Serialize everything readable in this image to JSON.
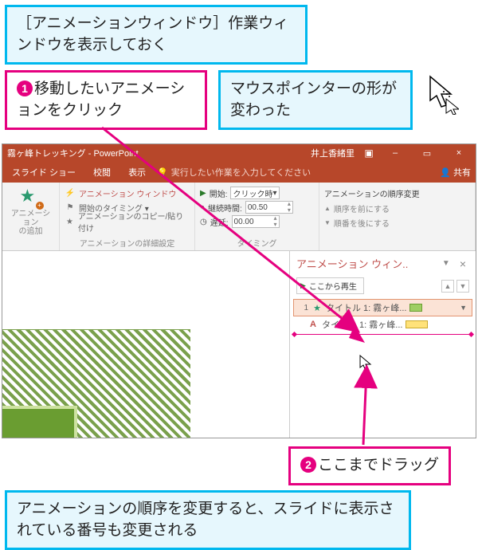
{
  "callouts": {
    "c1": "［アニメーションウィンドウ］作業ウィンドウを表示しておく",
    "c2_num": "1",
    "c2": "移動したいアニメーションをクリック",
    "c3": "マウスポインターの形が変わった",
    "c4_num": "2",
    "c4": "ここまでドラッグ",
    "c5": "アニメーションの順序を変更すると、スライドに表示されている番号も変更される"
  },
  "titlebar": {
    "appname": "霧ヶ峰トレッキング - PowerPoint",
    "user": "井上香緒里",
    "min": "–",
    "max": "▭",
    "close": "×"
  },
  "tabs": {
    "slideshow": "スライド ショー",
    "review": "校閲",
    "view": "表示",
    "tellme_icon": "💡",
    "tellme": "実行したい作業を入力してください",
    "share_icon": "👤",
    "share": "共有"
  },
  "ribbon": {
    "rg1": {
      "label1": "アニメーション",
      "label2": "の追加",
      "group": ""
    },
    "rg2": {
      "l1": "アニメーション ウィンドウ",
      "l2": "開始のタイミング",
      "l3": "アニメーションのコピー/貼り付け",
      "group": "アニメーションの詳細設定"
    },
    "rg3": {
      "start_lbl": "開始:",
      "start_val": "クリック時",
      "dur_lbl": "継続時間:",
      "dur_val": "00.50",
      "delay_lbl": "遅延:",
      "delay_val": "00.00",
      "group": "タイミング"
    },
    "rg4": {
      "hdr": "アニメーションの順序変更",
      "up": "順序を前にする",
      "down": "順番を後にする"
    }
  },
  "pane": {
    "title": "アニメーション ウィン..",
    "dropdown": "▼",
    "close": "×",
    "play": "ここから再生",
    "item1_num": "1",
    "item1_txt": "タイトル 1: 霧ヶ峰...",
    "item2_txt": "タイトル 1: 霧ヶ峰..."
  }
}
